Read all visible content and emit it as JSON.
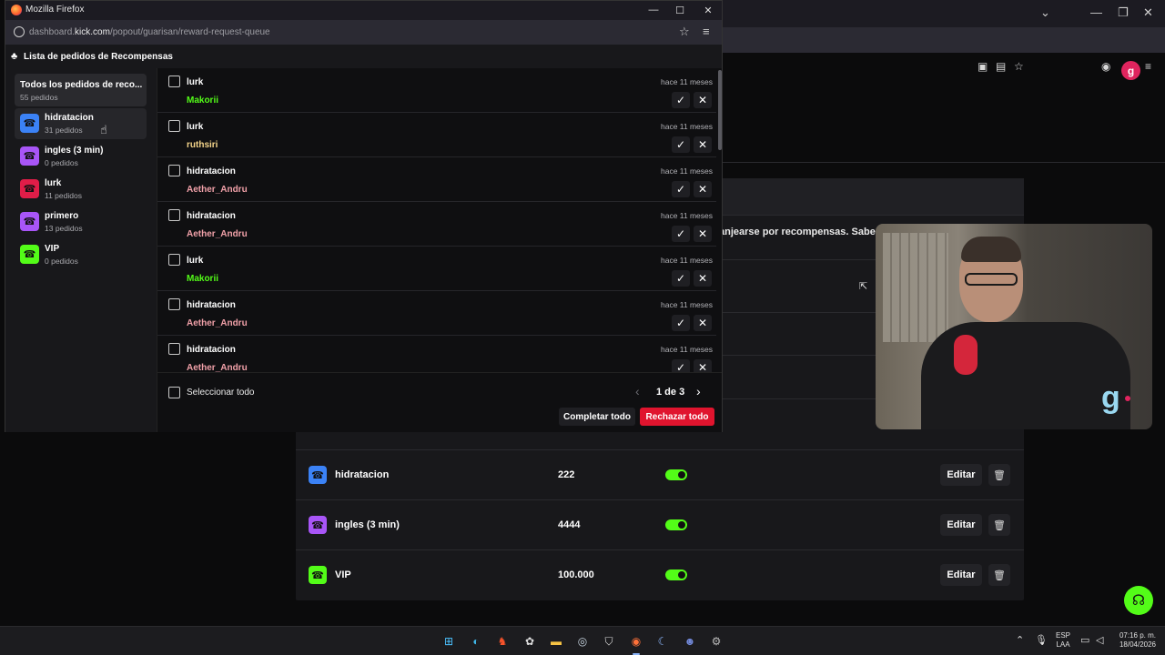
{
  "colors": {
    "kick_green": "#53fc18",
    "reject_red": "#e0142e",
    "hidratacion": "#3b82f6",
    "ingles": "#a855f7",
    "lurk": "#e11d48",
    "primero": "#a855f7",
    "vip": "#53fc18",
    "user_makorii": "#53fc18",
    "user_ruthsiri": "#f5d58a",
    "user_aether": "#f0a0a8"
  },
  "popup": {
    "window_title": "Mozilla Firefox",
    "url_host_prefix": "dashboard.",
    "url_host_bold": "kick.com",
    "url_path": "/popout/guarisan/reward-request-queue",
    "header_title": "Lista de pedidos de Recompensas",
    "sidebar": {
      "all_title": "Todos los pedidos de reco...",
      "all_count": "55 pedidos",
      "items": [
        {
          "name": "hidratacion",
          "count": "31 pedidos",
          "icon": "gift-icon"
        },
        {
          "name": "ingles (3 min)",
          "count": "0 pedidos",
          "icon": "gift-icon"
        },
        {
          "name": "lurk",
          "count": "11 pedidos",
          "icon": "gift-icon"
        },
        {
          "name": "primero",
          "count": "13 pedidos",
          "icon": "gift-icon"
        },
        {
          "name": "VIP",
          "count": "0 pedidos",
          "icon": "gift-icon"
        }
      ]
    },
    "queue": [
      {
        "reward": "lurk",
        "user": "Makorii",
        "time": "hace 11 meses"
      },
      {
        "reward": "lurk",
        "user": "ruthsiri",
        "time": "hace 11 meses"
      },
      {
        "reward": "hidratacion",
        "user": "Aether_Andru",
        "time": "hace 11 meses"
      },
      {
        "reward": "hidratacion",
        "user": "Aether_Andru",
        "time": "hace 11 meses"
      },
      {
        "reward": "lurk",
        "user": "Makorii",
        "time": "hace 11 meses"
      },
      {
        "reward": "hidratacion",
        "user": "Aether_Andru",
        "time": "hace 11 meses"
      },
      {
        "reward": "hidratacion",
        "user": "Aether_Andru",
        "time": "hace 11 meses"
      }
    ],
    "footer": {
      "select_all": "Seleccionar todo",
      "page": "1 de 3",
      "complete_all": "Completar todo",
      "reject_all": "Rechazar todo"
    }
  },
  "background": {
    "info_text": "anjearse por recompensas. Saber más",
    "rewards": [
      {
        "name": "hidratacion",
        "cost": "222",
        "edit": "Editar"
      },
      {
        "name": "ingles (3 min)",
        "cost": "4444",
        "edit": "Editar"
      },
      {
        "name": "VIP",
        "cost": "100.000",
        "edit": "Editar"
      }
    ]
  },
  "taskbar": {
    "lang_top": "ESP",
    "lang_bottom": "LAA",
    "time": "07:16 p. m.",
    "date": "18/04/2026"
  }
}
